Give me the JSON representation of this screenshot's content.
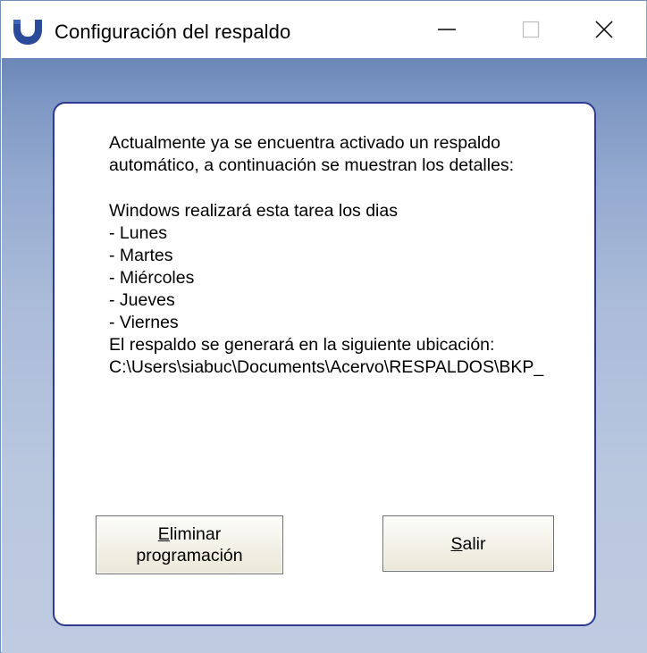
{
  "window": {
    "title": "Configuración del respaldo",
    "icon": "app-logo-icon",
    "controls": {
      "minimize_icon": "minimize-icon",
      "maximize_icon": "maximize-icon",
      "close_icon": "close-icon"
    }
  },
  "message": {
    "intro_line1": "Actualmente ya se encuentra activado un respaldo",
    "intro_line2": "automático, a continuación se muestran los detalles:",
    "schedule_heading": "Windows realizará esta tarea los dias",
    "days": [
      "- Lunes",
      "- Martes",
      "- Miércoles",
      "- Jueves",
      "- Viernes"
    ],
    "location_label": "El respaldo se generará en la siguiente ubicación:",
    "location_path": "C:\\Users\\siabuc\\Documents\\Acervo\\RESPALDOS\\BKP_"
  },
  "buttons": {
    "delete_mnemonic": "E",
    "delete_rest_line1": "liminar",
    "delete_line2": "programación",
    "exit_mnemonic": "S",
    "exit_rest": "alir"
  },
  "colors": {
    "panel_border": "#2d3a8f",
    "client_gradient_top": "#6b87b8",
    "client_gradient_bottom": "#bfcbe1",
    "button_face": "#f4f3ea"
  }
}
